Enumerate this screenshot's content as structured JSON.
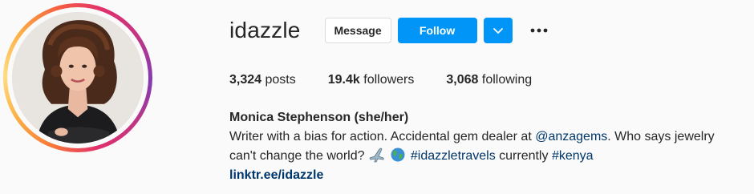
{
  "profile": {
    "username": "idazzle",
    "buttons": {
      "message": "Message",
      "follow": "Follow"
    },
    "stats": {
      "posts_count": "3,324",
      "posts_label": "posts",
      "followers_count": "19.4k",
      "followers_label": "followers",
      "following_count": "3,068",
      "following_label": "following"
    },
    "bio": {
      "full_name": "Monica Stephenson (she/her)",
      "line1_text": "Writer with a bias for action. Accidental gem dealer at ",
      "line1_mention": "@anzagems",
      "line1_tail": ". Who says jewelry",
      "line2_text": "can't change the world? ",
      "line2_hashtag1": "#idazzletravels",
      "line2_mid": " currently ",
      "line2_hashtag2": "#kenya",
      "link": "linktr.ee/idazzle"
    }
  },
  "icons": {
    "dropdown": "chevron-down-icon",
    "more": "more-options-icon",
    "emoji1": "airplane-emoji-icon",
    "emoji2": "globe-emoji-icon"
  },
  "colors": {
    "follow_blue": "#0095f6",
    "link_blue": "#00376b",
    "text": "#262626",
    "background": "#fafafa"
  }
}
